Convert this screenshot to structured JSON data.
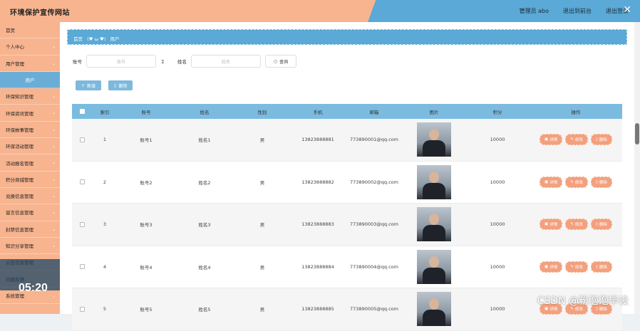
{
  "app": {
    "title": "环境保护宣传网站"
  },
  "header": {
    "user": "管理员 abo",
    "exit_front": "退出到前台",
    "exit_login": "退出登录"
  },
  "sidebar": {
    "items": [
      {
        "label": "首页"
      },
      {
        "label": "个人中心"
      },
      {
        "label": "用户管理"
      },
      {
        "label": "用户",
        "sub": true
      },
      {
        "label": "环保知识管理"
      },
      {
        "label": "环保资讯管理"
      },
      {
        "label": "环保故事管理"
      },
      {
        "label": "环保活动管理"
      },
      {
        "label": "活动报名管理"
      },
      {
        "label": "积分商城管理"
      },
      {
        "label": "兑换信息管理"
      },
      {
        "label": "留言信息管理"
      },
      {
        "label": "封禁信息管理"
      },
      {
        "label": "知识分享管理"
      },
      {
        "label": "公告信息管理"
      },
      {
        "label": "问题反馈"
      },
      {
        "label": "系统管理"
      }
    ]
  },
  "video": {
    "time": "05:20"
  },
  "breadcrumb": {
    "home": "首页",
    "current": "用户"
  },
  "search": {
    "account_label": "账号",
    "account_placeholder": "账号",
    "name_label": "姓名",
    "name_placeholder": "姓名",
    "button": "查询"
  },
  "actions": {
    "add": "新增",
    "delete": "删除"
  },
  "table": {
    "headers": [
      "索引",
      "账号",
      "姓名",
      "性别",
      "手机",
      "邮箱",
      "图片",
      "积分",
      "操作"
    ],
    "rows": [
      {
        "index": "1",
        "account": "账号1",
        "name": "姓名1",
        "gender": "男",
        "phone": "13823888881",
        "email": "773890001@qq.com",
        "points": "10000"
      },
      {
        "index": "2",
        "account": "账号2",
        "name": "姓名2",
        "gender": "男",
        "phone": "13823888882",
        "email": "773890002@qq.com",
        "points": "10000"
      },
      {
        "index": "3",
        "account": "账号3",
        "name": "姓名3",
        "gender": "男",
        "phone": "13823888883",
        "email": "773890003@qq.com",
        "points": "10000"
      },
      {
        "index": "4",
        "account": "账号4",
        "name": "姓名4",
        "gender": "男",
        "phone": "13823888884",
        "email": "773890004@qq.com",
        "points": "10000"
      },
      {
        "index": "5",
        "account": "账号5",
        "name": "姓名5",
        "gender": "男",
        "phone": "13823888885",
        "email": "773890005@qq.com",
        "points": "10000"
      }
    ],
    "ops": {
      "detail": "详情",
      "edit": "修改",
      "delete": "删除"
    }
  },
  "watermark": "CSDN @粉泡泡毕设",
  "colors": {
    "accent": "#5aa9d6",
    "peach": "#f7b48f",
    "op_button": "#f3a07e"
  }
}
